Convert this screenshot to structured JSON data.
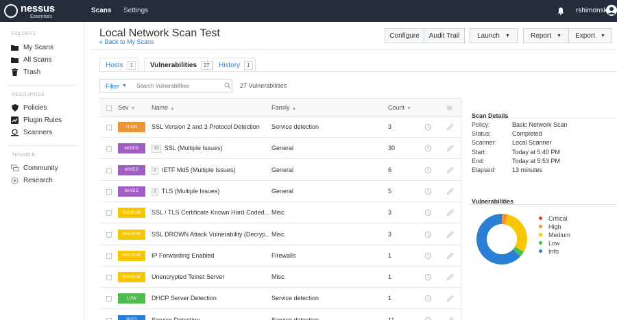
{
  "app": {
    "logo_name": "nessus",
    "logo_sub": "Essentials",
    "nav_scans": "Scans",
    "nav_settings": "Settings",
    "username": "rshimonski"
  },
  "sidebar": {
    "folders_heading": "FOLDERS",
    "my_scans": "My Scans",
    "all_scans": "All Scans",
    "trash": "Trash",
    "resources_heading": "RESOURCES",
    "policies": "Policies",
    "plugin_rules": "Plugin Rules",
    "scanners": "Scanners",
    "tenable_heading": "TENABLE",
    "community": "Community",
    "research": "Research"
  },
  "header": {
    "title": "Local Network Scan Test",
    "back": "« Back to My Scans",
    "configure": "Configure",
    "audit_trail": "Audit Trail",
    "launch": "Launch",
    "report": "Report",
    "export": "Export"
  },
  "tabs": [
    {
      "label": "Hosts",
      "count": "1"
    },
    {
      "label": "Vulnerabilities",
      "count": "27"
    },
    {
      "label": "History",
      "count": "1"
    }
  ],
  "filter": {
    "label": "Filter",
    "placeholder": "Search Vulnerabilities",
    "count_text": "27 Vulnerabilities"
  },
  "table": {
    "headers": {
      "sev": "Sev",
      "name": "Name",
      "family": "Family",
      "count": "Count"
    },
    "rows": [
      {
        "sev": "HIGH",
        "sev_class": "high",
        "group": "",
        "name": "SSL Version 2 and 3 Protocol Detection",
        "family": "Service detection",
        "count": "3"
      },
      {
        "sev": "MIXED",
        "sev_class": "mixed",
        "group": "10",
        "name": "SSL (Multiple Issues)",
        "family": "General",
        "count": "30"
      },
      {
        "sev": "MIXED",
        "sev_class": "mixed",
        "group": "2",
        "name": "IETF Md5 (Multiple Issues)",
        "family": "General",
        "count": "6"
      },
      {
        "sev": "MIXED",
        "sev_class": "mixed",
        "group": "2",
        "name": "TLS (Multiple Issues)",
        "family": "General",
        "count": "5"
      },
      {
        "sev": "MEDIUM",
        "sev_class": "medium",
        "group": "",
        "name": "SSL / TLS Certificate Known Hard Coded...",
        "family": "Misc.",
        "count": "3"
      },
      {
        "sev": "MEDIUM",
        "sev_class": "medium",
        "group": "",
        "name": "SSL DROWN Attack Vulnerability (Decryp...",
        "family": "Misc.",
        "count": "3"
      },
      {
        "sev": "MEDIUM",
        "sev_class": "medium",
        "group": "",
        "name": "IP Forwarding Enabled",
        "family": "Firewalls",
        "count": "1"
      },
      {
        "sev": "MEDIUM",
        "sev_class": "medium",
        "group": "",
        "name": "Unencrypted Telnet Server",
        "family": "Misc.",
        "count": "1"
      },
      {
        "sev": "LOW",
        "sev_class": "low",
        "group": "",
        "name": "DHCP Server Detection",
        "family": "Service detection",
        "count": "1"
      },
      {
        "sev": "INFO",
        "sev_class": "info",
        "group": "",
        "name": "Service Detection",
        "family": "Service detection",
        "count": "11"
      }
    ]
  },
  "scan_details": {
    "title": "Scan Details",
    "items": [
      {
        "label": "Policy:",
        "value": "Basic Network Scan"
      },
      {
        "label": "Status:",
        "value": "Completed"
      },
      {
        "label": "Scanner:",
        "value": "Local Scanner"
      },
      {
        "label": "Start:",
        "value": "Today at 5:40 PM"
      },
      {
        "label": "End:",
        "value": "Today at 5:53 PM"
      },
      {
        "label": "Elapsed:",
        "value": "13 minutes"
      }
    ]
  },
  "vulnerabilities": {
    "title": "Vulnerabilities",
    "legend": [
      {
        "label": "Critical",
        "color": "#d43f3a"
      },
      {
        "label": "High",
        "color": "#ee9336"
      },
      {
        "label": "Medium",
        "color": "#f6c600"
      },
      {
        "label": "Low",
        "color": "#4fbc4f"
      },
      {
        "label": "Info",
        "color": "#2b7fd4"
      }
    ]
  },
  "chart_data": {
    "type": "pie",
    "categories": [
      "Critical",
      "High",
      "Medium",
      "Low",
      "Info"
    ],
    "values": [
      0,
      1,
      8,
      1,
      17
    ],
    "colors": [
      "#d43f3a",
      "#ee9336",
      "#f6c600",
      "#4fbc4f",
      "#2b7fd4"
    ],
    "donut": true,
    "legend": "right"
  },
  "icons": {
    "bell": "bell-icon",
    "avatar": "user-avatar-icon",
    "search": "magnifier-icon",
    "settings": "gear-icon",
    "snooze": "clock-icon",
    "edit": "pencil-icon"
  }
}
